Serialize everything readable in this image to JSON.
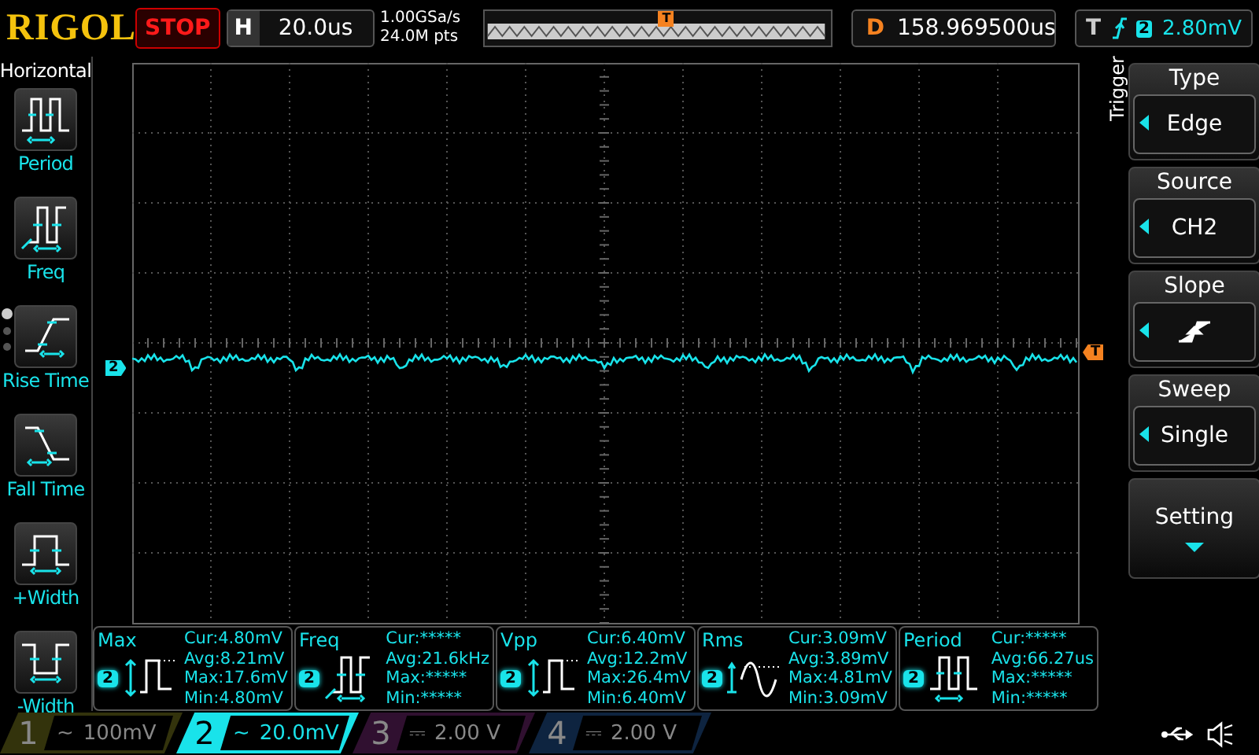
{
  "brand": "RIGOL",
  "run_state": "STOP",
  "timebase": {
    "label": "H",
    "value": "20.0us"
  },
  "sample": {
    "rate": "1.00GSa/s",
    "depth": "24.0M pts"
  },
  "delay": {
    "label": "D",
    "value": "158.969500us"
  },
  "trigger_status": {
    "label": "T",
    "channel": "2",
    "level": "2.80mV"
  },
  "left_menu": {
    "title": "Horizontal",
    "pages": [
      {
        "selected": true
      },
      {
        "selected": false
      },
      {
        "selected": false
      }
    ],
    "items": [
      {
        "label": "Period",
        "kind": "period"
      },
      {
        "label": "Freq",
        "kind": "freq"
      },
      {
        "label": "Rise Time",
        "kind": "rise"
      },
      {
        "label": "Fall Time",
        "kind": "fall"
      },
      {
        "label": "+Width",
        "kind": "pwidth"
      },
      {
        "label": "-Width",
        "kind": "nwidth"
      }
    ]
  },
  "markers": {
    "trigger_position": "T",
    "channel": "2",
    "trigger_level": "T"
  },
  "right_menu": {
    "title": "Trigger",
    "items": [
      {
        "label": "Type",
        "kind": "value",
        "value": "Edge"
      },
      {
        "label": "Source",
        "kind": "value",
        "value": "CH2"
      },
      {
        "label": "Slope",
        "kind": "slope"
      },
      {
        "label": "Sweep",
        "kind": "value",
        "value": "Single"
      },
      {
        "label": "Setting",
        "kind": "more"
      }
    ]
  },
  "measurements": [
    {
      "name": "Max",
      "channel": "2",
      "kind": "pulse",
      "lines": [
        "Cur:4.80mV",
        "Avg:8.21mV",
        "Max:17.6mV",
        "Min:4.80mV"
      ]
    },
    {
      "name": "Freq",
      "channel": "2",
      "kind": "freq",
      "lines": [
        "Cur:*****",
        "Avg:21.6kHz",
        "Max:*****",
        "Min:*****"
      ]
    },
    {
      "name": "Vpp",
      "channel": "2",
      "kind": "pulse",
      "lines": [
        "Cur:6.40mV",
        "Avg:12.2mV",
        "Max:26.4mV",
        "Min:6.40mV"
      ]
    },
    {
      "name": "Rms",
      "channel": "2",
      "kind": "sine",
      "lines": [
        "Cur:3.09mV",
        "Avg:3.89mV",
        "Max:4.81mV",
        "Min:3.09mV"
      ]
    },
    {
      "name": "Period",
      "channel": "2",
      "kind": "period",
      "lines": [
        "Cur:*****",
        "Avg:66.27us",
        "Max:*****",
        "Min:*****"
      ]
    }
  ],
  "channels": [
    {
      "number": "1",
      "coupling": "~",
      "scale": "100mV",
      "selected": false,
      "color": "#33330c"
    },
    {
      "number": "2",
      "coupling": "~",
      "scale": "20.0mV",
      "selected": true,
      "color": "#19e3ea"
    },
    {
      "number": "3",
      "coupling": "⎓",
      "scale": "2.00 V",
      "selected": false,
      "color": "#301030"
    },
    {
      "number": "4",
      "coupling": "⎓",
      "scale": "2.00 V",
      "selected": false,
      "color": "#0e2440"
    }
  ]
}
